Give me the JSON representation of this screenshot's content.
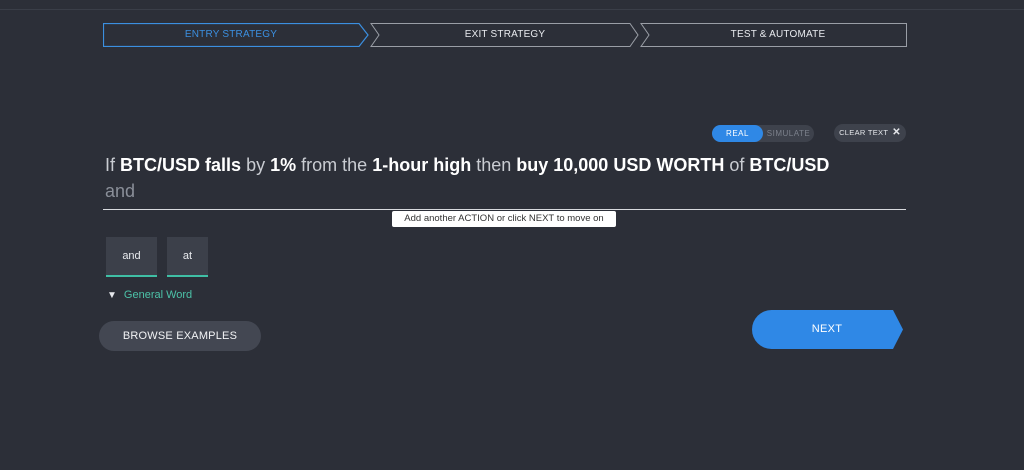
{
  "stepper": {
    "steps": [
      {
        "label": "ENTRY STRATEGY",
        "state": "active"
      },
      {
        "label": "EXIT STRATEGY",
        "state": "inactive"
      },
      {
        "label": "TEST & AUTOMATE",
        "state": "inactive"
      }
    ]
  },
  "mode_toggle": {
    "real": "REAL",
    "simulate": "SIMULATE",
    "selected": "REAL"
  },
  "clear_text": {
    "label": "CLEAR TEXT",
    "icon": "close-icon"
  },
  "sentence": {
    "if": "If",
    "pair": "BTC/USD",
    "falls": "falls",
    "by": "by",
    "percent": "1%",
    "from_the": "from the",
    "period": "1-hour high",
    "then": "then",
    "action": "buy 10,000 USD WORTH",
    "of": "of",
    "pair2": "BTC/USD",
    "next_word": "and"
  },
  "hint": "Add another ACTION or click NEXT to move on",
  "suggestions": [
    "and",
    "at"
  ],
  "filter": {
    "icon": "filter-icon",
    "label": "General Word"
  },
  "browse_label": "BROWSE EXAMPLES",
  "next_label": "NEXT",
  "colors": {
    "accent": "#2f88e6",
    "teal": "#3fbfa5",
    "background": "#2c2f38"
  }
}
